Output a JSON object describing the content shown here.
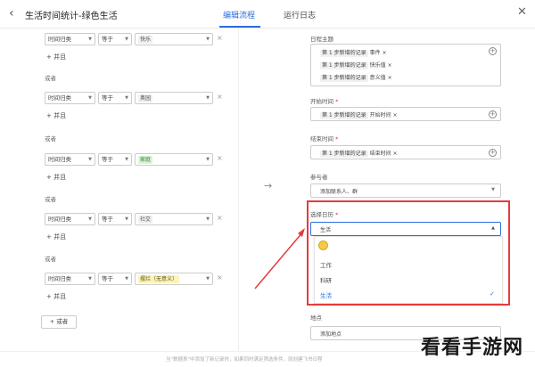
{
  "header": {
    "title": "生活时间统计-绿色生活",
    "tabs": [
      {
        "label": "编辑流程"
      },
      {
        "label": "运行日志"
      }
    ]
  },
  "left": {
    "rows": [
      {
        "field": "时间归类",
        "operator": "等于",
        "value": "快乐"
      },
      {
        "field": "时间归类",
        "operator": "等于",
        "value": "奥园"
      },
      {
        "field": "时间归类",
        "operator": "等于",
        "value": "家庭"
      },
      {
        "field": "时间归类",
        "operator": "等于",
        "value": "社交"
      },
      {
        "field": "时间归类",
        "operator": "等于",
        "value": "摆烂（无意义）"
      }
    ],
    "and_label": "并且",
    "or_label": "或者",
    "add_or_label": "或者"
  },
  "right": {
    "subject_label": "日程主题",
    "subject_lines": [
      {
        "step": "第 1 步新增的记录",
        "field": "事件"
      },
      {
        "step": "第 1 步新增的记录",
        "field": "快乐值"
      },
      {
        "step": "第 1 步新增的记录",
        "field": "意义值"
      }
    ],
    "start_label": "开始时间",
    "start_line": {
      "step": "第 1 步新增的记录",
      "field": "开始时间"
    },
    "end_label": "结束时间",
    "end_line": {
      "step": "第 1 步新增的记录",
      "field": "结束时间"
    },
    "participants_label": "参与者",
    "participants_placeholder": "添加联系人、群",
    "calendar_label": "选择日历",
    "calendar_value": "生活",
    "calendar_options": [
      "工作",
      "科研",
      "生活"
    ],
    "location_label": "地点",
    "location_placeholder": "添加地点"
  },
  "footer": {
    "text": "当\"数据表\"中添加了新记录时，如果同时满足筛选条件，就创建飞书日程"
  },
  "watermark": "看看手游网",
  "colors": {
    "accent": "#2b6de0",
    "highlight": "#e53b3b"
  }
}
